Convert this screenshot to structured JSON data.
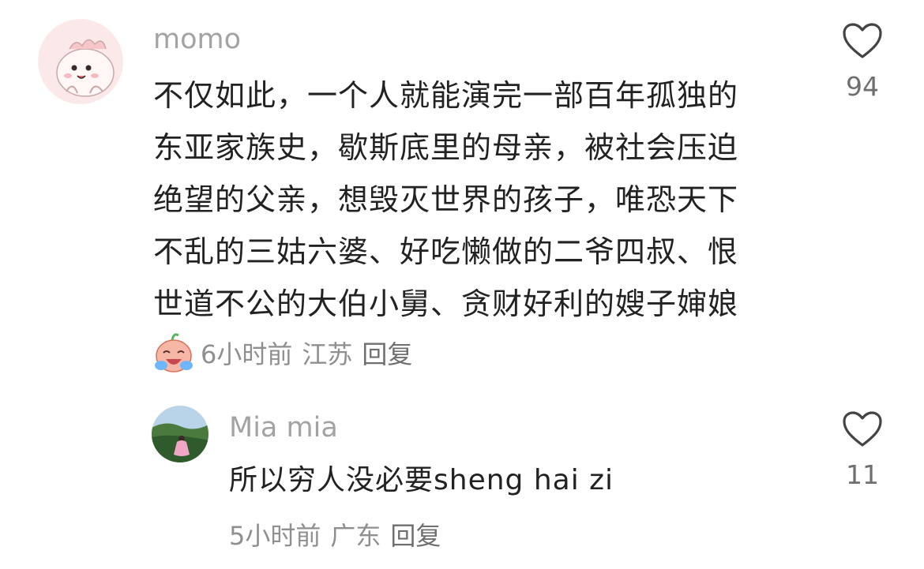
{
  "comments": [
    {
      "username": "momo",
      "avatar_icon": "pink-dinosaur-avatar",
      "text_lines": [
        "不仅如此，一个人就能演完一部百年孤独的",
        "东亚家族史，歇斯底里的母亲，被社会压迫",
        "绝望的父亲，想毁灭世界的孩子，唯恐天下",
        "不乱的三姑六婆、好吃懒做的二爷四叔、恨",
        "世道不公的大伯小舅、贪财好利的嫂子婶娘"
      ],
      "badge_icon": "crying-laughing-icon",
      "time": "6小时前",
      "location": "江苏",
      "reply_label": "回复",
      "likes": "94"
    },
    {
      "username": "Mia mia",
      "avatar_icon": "landscape-photo-avatar",
      "text_lines": [
        "所以穷人没必要sheng hai zi"
      ],
      "time": "5小时前",
      "location": "广东",
      "reply_label": "回复",
      "likes": "11"
    }
  ],
  "colors": {
    "username": "#a3a3a3",
    "body_text": "#222222",
    "meta_text": "#8f8f8f",
    "like_icon": "#444444"
  }
}
